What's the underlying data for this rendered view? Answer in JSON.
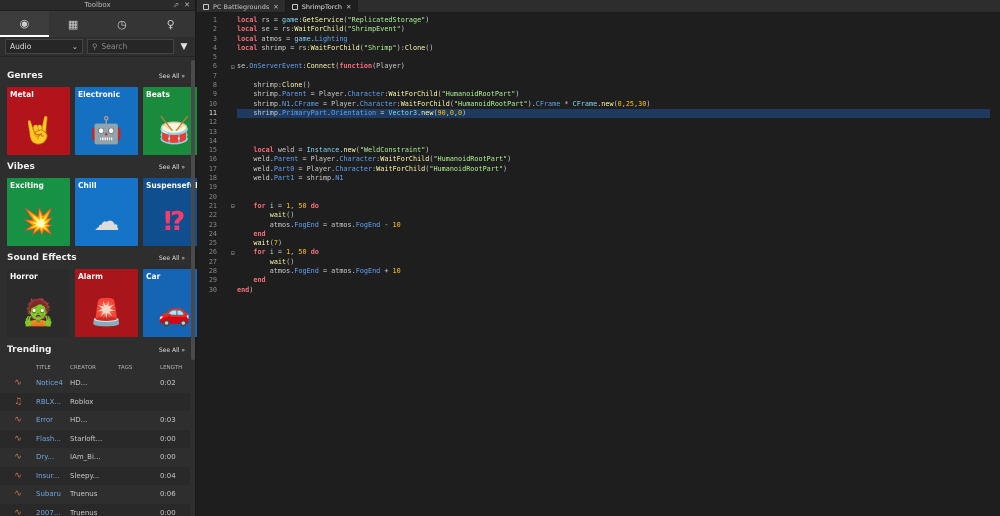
{
  "toolbox": {
    "title": "Toolbox",
    "category": "Audio",
    "search_placeholder": "Search",
    "sections": [
      {
        "heading": "Genres",
        "see_all": "See All »"
      },
      {
        "heading": "Vibes",
        "see_all": "See All »"
      },
      {
        "heading": "Sound Effects",
        "see_all": "See All »"
      },
      {
        "heading": "Trending",
        "see_all": "See All »"
      }
    ],
    "genres": [
      {
        "label": "Metal",
        "color": "#b3141b",
        "icon": "rock-hand-icon"
      },
      {
        "label": "Electronic",
        "color": "#1670c2",
        "icon": "robot-icon"
      },
      {
        "label": "Beats",
        "color": "#1a8a3c",
        "icon": "drum-icon"
      }
    ],
    "vibes": [
      {
        "label": "Exciting",
        "color": "#179244",
        "icon": "burst-icon"
      },
      {
        "label": "Chill",
        "color": "#1574c7",
        "icon": "cloud-icon"
      },
      {
        "label": "Suspenseful",
        "color": "#104f8f",
        "icon": "exclaim-question-icon"
      }
    ],
    "sound_effects": [
      {
        "label": "Horror",
        "color": "#2b2b2b",
        "icon": "zombie-icon"
      },
      {
        "label": "Alarm",
        "color": "#a8161b",
        "icon": "siren-icon"
      },
      {
        "label": "Car",
        "color": "#1565b4",
        "icon": "car-icon"
      }
    ],
    "trending_columns": [
      "TITLE",
      "CREATOR",
      "TAGS",
      "LENGTH"
    ],
    "trending": [
      {
        "title": "Notice4",
        "creator": "HD...",
        "tags": "",
        "length": "0:02",
        "icon": "waveform-icon"
      },
      {
        "title": "RBLX...",
        "creator": "Roblox",
        "tags": "",
        "length": "",
        "icon": "music-note-icon"
      },
      {
        "title": "Error",
        "creator": "HD...",
        "tags": "",
        "length": "0:03",
        "icon": "waveform-icon"
      },
      {
        "title": "Flash...",
        "creator": "Starloft...",
        "tags": "",
        "length": "0:00",
        "icon": "waveform-icon"
      },
      {
        "title": "Dry...",
        "creator": "IAm_Bi...",
        "tags": "",
        "length": "0:00",
        "icon": "waveform-icon"
      },
      {
        "title": "Insur...",
        "creator": "Sleepy...",
        "tags": "",
        "length": "0:04",
        "icon": "waveform-icon"
      },
      {
        "title": "Subaru",
        "creator": "Truenus",
        "tags": "",
        "length": "0:06",
        "icon": "waveform-icon"
      },
      {
        "title": "2007...",
        "creator": "Truenus",
        "tags": "",
        "length": "0:00",
        "icon": "waveform-icon"
      }
    ]
  },
  "editor": {
    "tabs": [
      {
        "label": "PC Battlegrounds",
        "active": false
      },
      {
        "label": "ShrimpTorch",
        "active": true
      }
    ],
    "current_line": 11,
    "code": [
      [
        [
          "kw",
          "local"
        ],
        [
          "op",
          " rs = "
        ],
        [
          "bi",
          "game"
        ],
        [
          "op",
          ":"
        ],
        [
          "fn",
          "GetService"
        ],
        [
          "op",
          "("
        ],
        [
          "str",
          "\"ReplicatedStorage\""
        ],
        [
          "op",
          ")"
        ]
      ],
      [
        [
          "kw",
          "local"
        ],
        [
          "op",
          " se = rs:"
        ],
        [
          "fn",
          "WaitForChild"
        ],
        [
          "op",
          "("
        ],
        [
          "str",
          "\"ShrimpEvent\""
        ],
        [
          "op",
          ")"
        ]
      ],
      [
        [
          "kw",
          "local"
        ],
        [
          "op",
          " atmos = "
        ],
        [
          "bi",
          "game"
        ],
        [
          "op",
          "."
        ],
        [
          "prop",
          "Lighting"
        ]
      ],
      [
        [
          "kw",
          "local"
        ],
        [
          "op",
          " shrimp = rs:"
        ],
        [
          "fn",
          "WaitForChild"
        ],
        [
          "op",
          "("
        ],
        [
          "str",
          "\"Shrimp\""
        ],
        [
          "op",
          "):"
        ],
        [
          "fn",
          "Clone"
        ],
        [
          "op",
          "()"
        ]
      ],
      [],
      [
        [
          "op",
          "se."
        ],
        [
          "prop",
          "OnServerEvent"
        ],
        [
          "op",
          ":"
        ],
        [
          "fn",
          "Connect"
        ],
        [
          "op",
          "("
        ],
        [
          "kw",
          "function"
        ],
        [
          "op",
          "(Player)"
        ]
      ],
      [],
      [
        [
          "op",
          "    shrimp:"
        ],
        [
          "fn",
          "Clone"
        ],
        [
          "op",
          "()"
        ]
      ],
      [
        [
          "op",
          "    shrimp."
        ],
        [
          "prop",
          "Parent"
        ],
        [
          "op",
          " = Player."
        ],
        [
          "prop",
          "Character"
        ],
        [
          "op",
          ":"
        ],
        [
          "fn",
          "WaitForChild"
        ],
        [
          "op",
          "("
        ],
        [
          "str",
          "\"HumanoidRootPart\""
        ],
        [
          "op",
          ")"
        ]
      ],
      [
        [
          "op",
          "    shrimp."
        ],
        [
          "prop",
          "N1"
        ],
        [
          "op",
          "."
        ],
        [
          "prop",
          "CFrame"
        ],
        [
          "op",
          " = Player."
        ],
        [
          "prop",
          "Character"
        ],
        [
          "op",
          ":"
        ],
        [
          "fn",
          "WaitForChild"
        ],
        [
          "op",
          "("
        ],
        [
          "str",
          "\"HumanoidRootPart\""
        ],
        [
          "op",
          ")."
        ],
        [
          "prop",
          "CFrame"
        ],
        [
          "op",
          " * "
        ],
        [
          "bi",
          "CFrame"
        ],
        [
          "op",
          "."
        ],
        [
          "fn",
          "new"
        ],
        [
          "op",
          "("
        ],
        [
          "num",
          "0"
        ],
        [
          "op",
          ","
        ],
        [
          "num",
          "25"
        ],
        [
          "op",
          ","
        ],
        [
          "num",
          "30"
        ],
        [
          "op",
          ")"
        ]
      ],
      [
        [
          "op",
          "    shrimp."
        ],
        [
          "prop",
          "PrimaryPart"
        ],
        [
          "op",
          "."
        ],
        [
          "prop",
          "Orientation"
        ],
        [
          "op",
          " = "
        ],
        [
          "bi",
          "Vector3"
        ],
        [
          "op",
          "."
        ],
        [
          "fn",
          "new"
        ],
        [
          "op",
          "("
        ],
        [
          "num",
          "90"
        ],
        [
          "op",
          ","
        ],
        [
          "num",
          "0"
        ],
        [
          "op",
          ","
        ],
        [
          "num",
          "0"
        ],
        [
          "op",
          ")"
        ]
      ],
      [],
      [],
      [],
      [
        [
          "op",
          "    "
        ],
        [
          "kw",
          "local"
        ],
        [
          "op",
          " weld = "
        ],
        [
          "bi",
          "Instance"
        ],
        [
          "op",
          "."
        ],
        [
          "fn",
          "new"
        ],
        [
          "op",
          "("
        ],
        [
          "str",
          "\"WeldConstraint\""
        ],
        [
          "op",
          ")"
        ]
      ],
      [
        [
          "op",
          "    weld."
        ],
        [
          "prop",
          "Parent"
        ],
        [
          "op",
          " = Player."
        ],
        [
          "prop",
          "Character"
        ],
        [
          "op",
          ":"
        ],
        [
          "fn",
          "WaitForChild"
        ],
        [
          "op",
          "("
        ],
        [
          "str",
          "\"HumanoidRootPart\""
        ],
        [
          "op",
          ")"
        ]
      ],
      [
        [
          "op",
          "    weld."
        ],
        [
          "prop",
          "Part0"
        ],
        [
          "op",
          " = Player."
        ],
        [
          "prop",
          "Character"
        ],
        [
          "op",
          ":"
        ],
        [
          "fn",
          "WaitForChild"
        ],
        [
          "op",
          "("
        ],
        [
          "str",
          "\"HumanoidRootPart\""
        ],
        [
          "op",
          ")"
        ]
      ],
      [
        [
          "op",
          "    weld."
        ],
        [
          "prop",
          "Part1"
        ],
        [
          "op",
          " = shrimp."
        ],
        [
          "prop",
          "N1"
        ]
      ],
      [],
      [],
      [
        [
          "op",
          "    "
        ],
        [
          "kw",
          "for"
        ],
        [
          "op",
          " i = "
        ],
        [
          "num",
          "1"
        ],
        [
          "op",
          ", "
        ],
        [
          "num",
          "50"
        ],
        [
          "op",
          " "
        ],
        [
          "kw",
          "do"
        ]
      ],
      [
        [
          "op",
          "        "
        ],
        [
          "fn",
          "wait"
        ],
        [
          "op",
          "()"
        ]
      ],
      [
        [
          "op",
          "        atmos."
        ],
        [
          "prop",
          "FogEnd"
        ],
        [
          "op",
          " = atmos."
        ],
        [
          "prop",
          "FogEnd"
        ],
        [
          "op",
          " - "
        ],
        [
          "num",
          "10"
        ]
      ],
      [
        [
          "op",
          "    "
        ],
        [
          "kw",
          "end"
        ]
      ],
      [
        [
          "op",
          "    "
        ],
        [
          "fn",
          "wait"
        ],
        [
          "op",
          "("
        ],
        [
          "num",
          "7"
        ],
        [
          "op",
          ")"
        ]
      ],
      [
        [
          "op",
          "    "
        ],
        [
          "kw",
          "for"
        ],
        [
          "op",
          " i = "
        ],
        [
          "num",
          "1"
        ],
        [
          "op",
          ", "
        ],
        [
          "num",
          "50"
        ],
        [
          "op",
          " "
        ],
        [
          "kw",
          "do"
        ]
      ],
      [
        [
          "op",
          "        "
        ],
        [
          "fn",
          "wait"
        ],
        [
          "op",
          "()"
        ]
      ],
      [
        [
          "op",
          "        atmos."
        ],
        [
          "prop",
          "FogEnd"
        ],
        [
          "op",
          " = atmos."
        ],
        [
          "prop",
          "FogEnd"
        ],
        [
          "op",
          " + "
        ],
        [
          "num",
          "10"
        ]
      ],
      [
        [
          "op",
          "    "
        ],
        [
          "kw",
          "end"
        ]
      ],
      [
        [
          "kw",
          "end"
        ],
        [
          "op",
          ")"
        ]
      ]
    ]
  }
}
